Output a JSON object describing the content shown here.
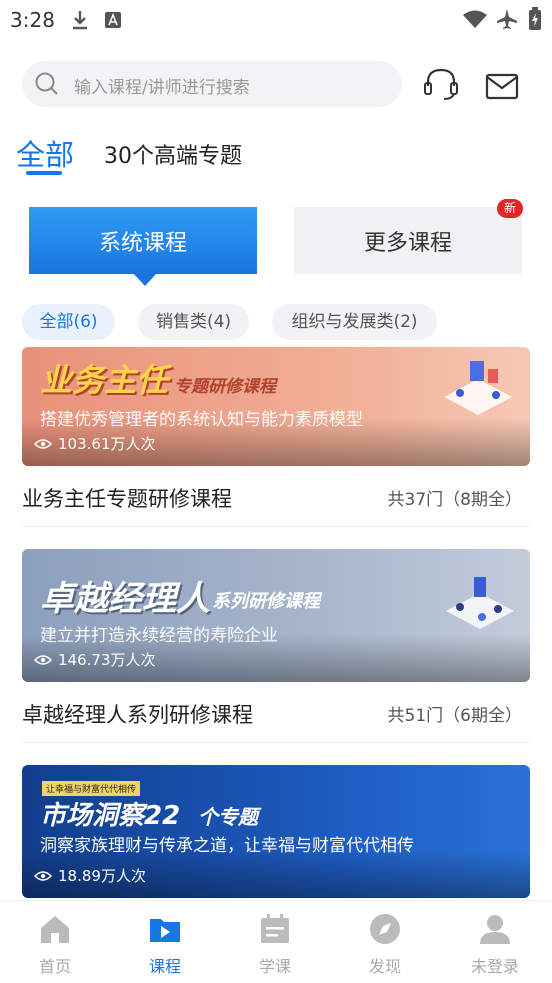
{
  "status_bar": {
    "time": "3:28"
  },
  "search": {
    "placeholder": "输入课程/讲师进行搜索"
  },
  "header": {
    "tab_all": "全部",
    "tab_desc": "30个高端专题"
  },
  "segments": {
    "system": "系统课程",
    "more": "更多课程",
    "new_badge": "新"
  },
  "chips": [
    {
      "label": "全部(6)"
    },
    {
      "label": "销售类(4)"
    },
    {
      "label": "组织与发展类(2)"
    }
  ],
  "courses": [
    {
      "banner_title": "业务主任",
      "banner_title_suffix": "专题研修课程",
      "banner_subtitle": "搭建优秀管理者的系统认知与能力素质模型",
      "views": "103.61万人次",
      "title": "业务主任专题研修课程",
      "meta": "共37门（8期全）"
    },
    {
      "banner_title": "卓越经理人",
      "banner_title_suffix": "系列研修课程",
      "banner_subtitle": "建立并打造永续经营的寿险企业",
      "views": "146.73万人次",
      "title": "卓越经理人系列研修课程",
      "meta": "共51门（6期全）"
    },
    {
      "banner_tag": "让幸福与财富代代相传",
      "banner_title": "市场洞察22",
      "banner_title_suffix": "个专题",
      "banner_subtitle": "洞察家族理财与传承之道，让幸福与财富代代相传",
      "views": "18.89万人次"
    }
  ],
  "bottom_nav": [
    {
      "label": "首页",
      "icon": "home-icon"
    },
    {
      "label": "课程",
      "icon": "course-play-icon",
      "active": true
    },
    {
      "label": "学课",
      "icon": "calendar-icon"
    },
    {
      "label": "发现",
      "icon": "compass-icon"
    },
    {
      "label": "未登录",
      "icon": "user-icon"
    }
  ],
  "colors": {
    "accent": "#1677e5",
    "badge": "#e52525"
  }
}
